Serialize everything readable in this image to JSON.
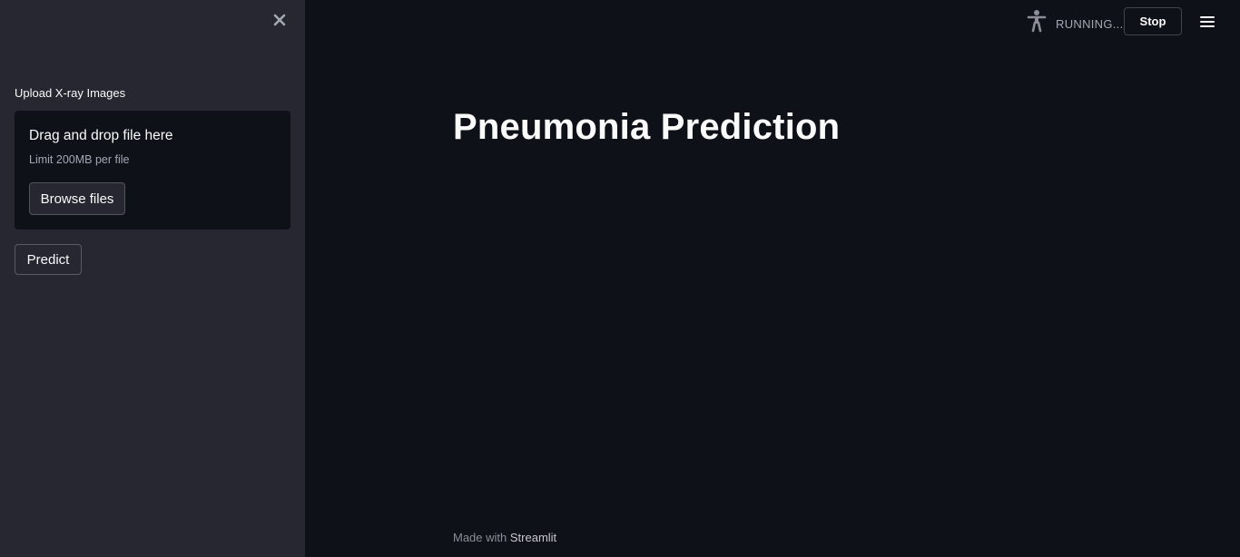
{
  "sidebar": {
    "close_icon": "close-icon",
    "uploader": {
      "label": "Upload X-ray Images",
      "dropzone_title": "Drag and drop file here",
      "limit_text": "Limit 200MB per file",
      "browse_label": "Browse files"
    },
    "predict_label": "Predict"
  },
  "main": {
    "title": "Pneumonia Prediction"
  },
  "toolbar": {
    "status_icon": "running-person-icon",
    "status_text": "RUNNING...",
    "stop_label": "Stop",
    "menu_icon": "hamburger-menu-icon"
  },
  "footer": {
    "prefix": "Made with ",
    "brand": "Streamlit"
  },
  "colors": {
    "main_background": "#0e1117",
    "sidebar_background": "#262730",
    "text": "#fafafa",
    "muted_text": "#a3a8b4"
  }
}
